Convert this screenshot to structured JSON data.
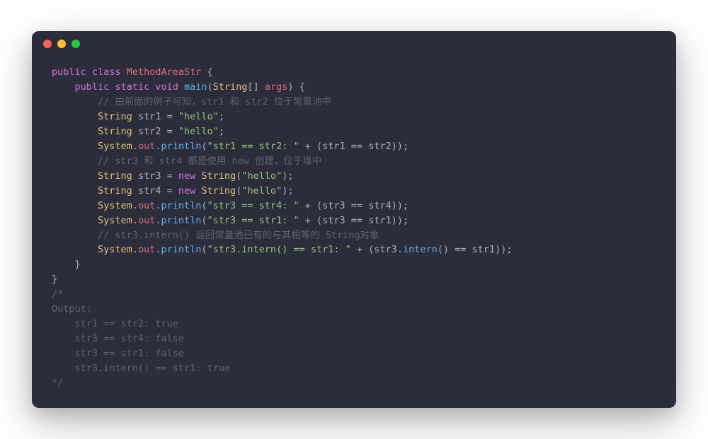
{
  "token": {
    "public": "public",
    "class": "class",
    "static": "static",
    "void": "void",
    "new": "new",
    "className": "MethodAreaStr",
    "main": "main",
    "String": "String",
    "args": "args",
    "System": "System",
    "out": "out",
    "println": "println",
    "intern": "intern",
    "str1": "str1",
    "str2": "str2",
    "str3": "str3",
    "str4": "str4",
    "hello": "\"hello\"",
    "msg12": "\"str1 == str2: \"",
    "msg34": "\"str3 == str4: \"",
    "msg31": "\"str3 == str1: \"",
    "msgIntern": "\"str3.intern() == str1: \"",
    "comment1": "// 由前面的例子可知，str1 和 str2 位于常量池中",
    "comment2": "// str3 和 str4 都是使用 new 创建，位于堆中",
    "comment3": "// str3.intern() 返回常量池已有的与其相等的 String对象",
    "blockOpen": "/*",
    "output": "Output:",
    "out1": "    str1 == str2: true",
    "out2": "    str3 == str4: false",
    "out3": "    str3 == str1: false",
    "out4": "    str3.intern() == str1: true",
    "blockClose": "*/"
  }
}
